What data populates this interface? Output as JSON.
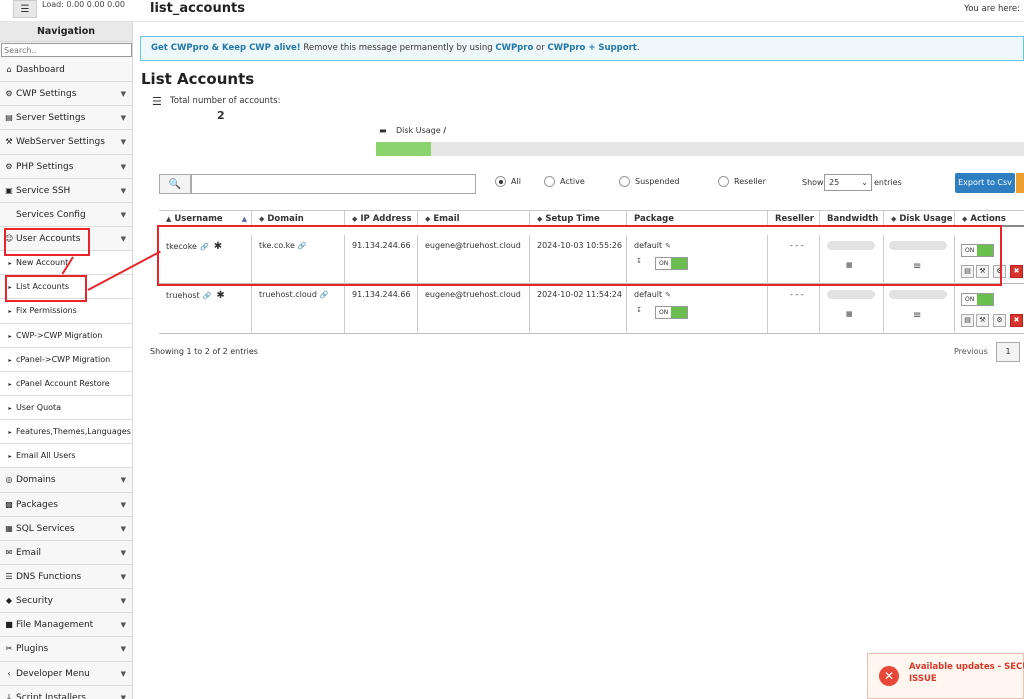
{
  "topbar": {
    "load_text": "Load: 0.00  0.00  0.00",
    "page_title": "list_accounts",
    "you_are_here": "You are here:"
  },
  "sidebar": {
    "heading": "Navigation",
    "search_placeholder": "Search..",
    "items": [
      {
        "label": "Dashboard",
        "icon": "home-icon",
        "caret": false,
        "sub": false
      },
      {
        "label": "CWP Settings",
        "icon": "gear-icon",
        "caret": true,
        "sub": false
      },
      {
        "label": "Server Settings",
        "icon": "server-icon",
        "caret": true,
        "sub": false
      },
      {
        "label": "WebServer Settings",
        "icon": "wrench-icon",
        "caret": true,
        "sub": false
      },
      {
        "label": "PHP Settings",
        "icon": "cog-icon",
        "caret": true,
        "sub": false
      },
      {
        "label": "Service SSH",
        "icon": "terminal-icon",
        "caret": true,
        "sub": false
      },
      {
        "label": "Services Config",
        "icon": "",
        "caret": true,
        "sub": false
      },
      {
        "label": "User Accounts",
        "icon": "user-icon",
        "caret": true,
        "sub": false
      },
      {
        "label": "New Account",
        "icon": "triangle-icon",
        "caret": false,
        "sub": true
      },
      {
        "label": "List Accounts",
        "icon": "triangle-icon",
        "caret": false,
        "sub": true
      },
      {
        "label": "Fix Permissions",
        "icon": "triangle-icon",
        "caret": false,
        "sub": true
      },
      {
        "label": "CWP->CWP Migration",
        "icon": "triangle-icon",
        "caret": false,
        "sub": true
      },
      {
        "label": "cPanel->CWP Migration",
        "icon": "triangle-icon",
        "caret": false,
        "sub": true
      },
      {
        "label": "cPanel Account Restore",
        "icon": "triangle-icon",
        "caret": false,
        "sub": true
      },
      {
        "label": "User Quota",
        "icon": "triangle-icon",
        "caret": false,
        "sub": true
      },
      {
        "label": "Features,Themes,Languages",
        "icon": "triangle-icon",
        "caret": false,
        "sub": true
      },
      {
        "label": "Email All Users",
        "icon": "triangle-icon",
        "caret": false,
        "sub": true
      },
      {
        "label": "Domains",
        "icon": "globe-icon",
        "caret": true,
        "sub": false
      },
      {
        "label": "Packages",
        "icon": "package-icon",
        "caret": true,
        "sub": false
      },
      {
        "label": "SQL Services",
        "icon": "database-icon",
        "caret": true,
        "sub": false
      },
      {
        "label": "Email",
        "icon": "envelope-icon",
        "caret": true,
        "sub": false
      },
      {
        "label": "DNS Functions",
        "icon": "list-icon",
        "caret": true,
        "sub": false
      },
      {
        "label": "Security",
        "icon": "shield-icon",
        "caret": true,
        "sub": false
      },
      {
        "label": "File Management",
        "icon": "folder-icon",
        "caret": true,
        "sub": false
      },
      {
        "label": "Plugins",
        "icon": "plug-icon",
        "caret": true,
        "sub": false
      },
      {
        "label": "Developer Menu",
        "icon": "code-icon",
        "caret": true,
        "sub": false
      },
      {
        "label": "Script Installers",
        "icon": "download-icon",
        "caret": true,
        "sub": false
      }
    ]
  },
  "banner": {
    "lead": "Get CWPpro & Keep CWP alive!",
    "mid": " Remove this message permanently by using ",
    "link1": "CWPpro",
    "or": " or ",
    "link2": "CWPpro + Support",
    "end": "."
  },
  "main": {
    "title": "List Accounts",
    "total_label": "Total number of accounts:",
    "total_value": "2",
    "disk_label": "Disk Usage",
    "disk_sep": "/",
    "disk_fill_fraction": 0.085
  },
  "filters": {
    "radios": [
      {
        "label": "All",
        "checked": true
      },
      {
        "label": "Active",
        "checked": false
      },
      {
        "label": "Suspended",
        "checked": false
      },
      {
        "label": "Reseller",
        "checked": false
      }
    ],
    "show_label": "Show",
    "show_value": "25",
    "entries_label": "entries",
    "export_label": "Export to Csv"
  },
  "table": {
    "headers": [
      "Username",
      "Domain",
      "IP Address",
      "Email",
      "Setup Time",
      "Package",
      "Reseller",
      "Bandwidth",
      "Disk Usage",
      "Actions"
    ],
    "rows": [
      {
        "username": "tkecoke",
        "domain": "tke.co.ke",
        "ip": "91.134.244.66",
        "email": "eugene@truehost.cloud",
        "setup": "2024-10-03 10:55:26",
        "package": "default",
        "reseller": "- - -",
        "toggle": "ON",
        "action_toggle": "ON"
      },
      {
        "username": "truehost",
        "domain": "truehost.cloud",
        "ip": "91.134.244.66",
        "email": "eugene@truehost.cloud",
        "setup": "2024-10-02 11:54:24",
        "package": "default",
        "reseller": "- - -",
        "toggle": "ON",
        "action_toggle": "ON"
      }
    ]
  },
  "pagination": {
    "showing": "Showing 1 to 2 of 2 entries",
    "previous": "Previous",
    "page": "1"
  },
  "notification": {
    "line1": "Available updates - SECURITY",
    "line2": "ISSUE"
  },
  "colors": {
    "accent": "#2d7fc1",
    "annotation": "#e8252a",
    "toggle_on": "#6bbf4f"
  }
}
